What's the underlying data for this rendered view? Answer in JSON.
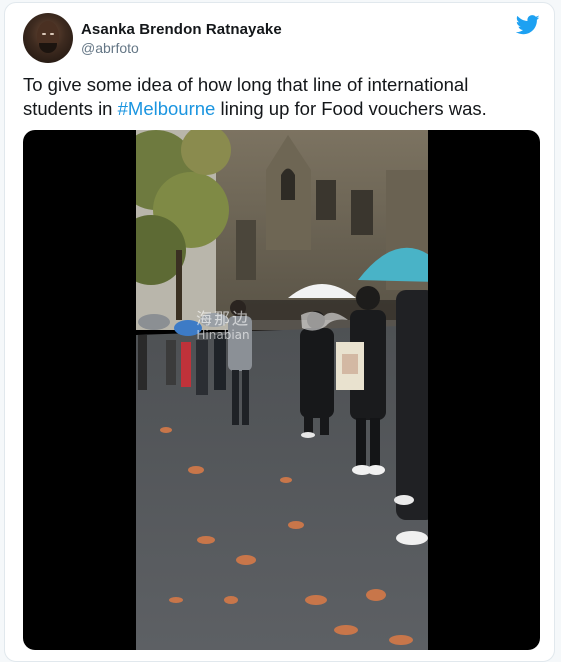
{
  "tweet": {
    "author_name": "Asanka Brendon Ratnayake",
    "author_handle": "@abrfoto",
    "text_before": "To give some idea of how long that line of international students in ",
    "hashtag": "#Melbourne",
    "text_after": " lining up for Food vouchers was.",
    "brand_icon": "twitter-bird-icon",
    "brand_color": "#1da1f2",
    "hashtag_color": "#1b95e0"
  },
  "media": {
    "type": "video",
    "watermark_cn": "海那边",
    "watermark_en": "Hinabian"
  }
}
